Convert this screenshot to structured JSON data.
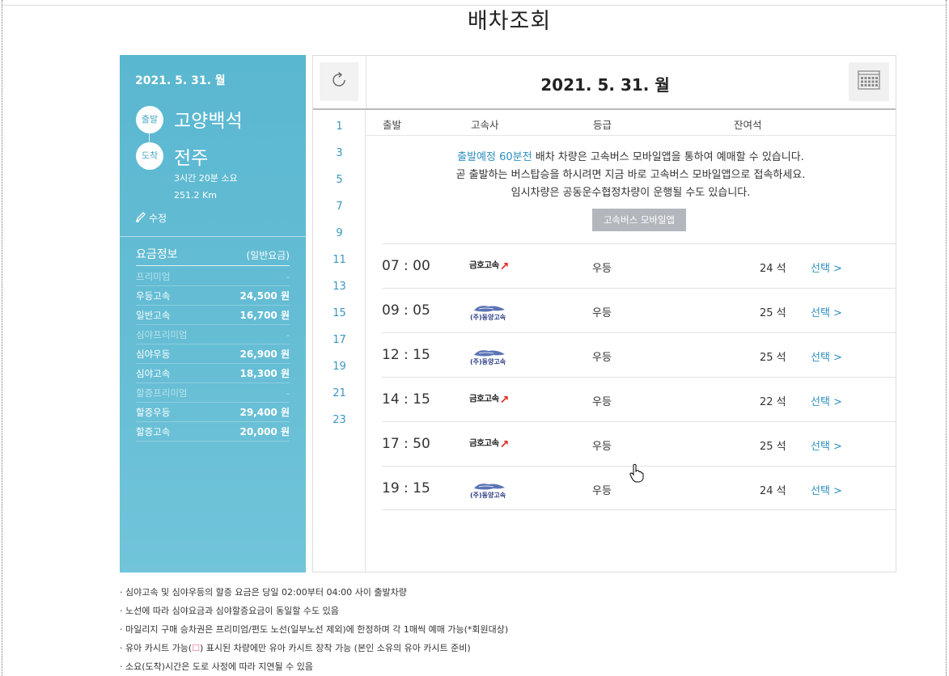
{
  "page": {
    "title": "배차조회"
  },
  "summary": {
    "date": "2021. 5. 31. 월",
    "departure_badge": "출발",
    "departure": "고양백석",
    "arrival_badge": "도착",
    "arrival": "전주",
    "duration": "3시간 20분 소요",
    "distance": "251.2 Km",
    "edit_label": "수정"
  },
  "fare": {
    "title": "요금정보",
    "subtitle": "(일반요금)",
    "rows": [
      {
        "label": "프리미엄",
        "value": "-"
      },
      {
        "label": "우등고속",
        "value": "24,500 원"
      },
      {
        "label": "일반고속",
        "value": "16,700 원"
      },
      {
        "label": "심야프리미엄",
        "value": "-"
      },
      {
        "label": "심야우등",
        "value": "26,900 원"
      },
      {
        "label": "심야고속",
        "value": "18,300 원"
      },
      {
        "label": "할증프리미엄",
        "value": "-"
      },
      {
        "label": "할증우등",
        "value": "29,400 원"
      },
      {
        "label": "할증고속",
        "value": "20,000 원"
      }
    ]
  },
  "schedule": {
    "date": "2021. 5. 31. 월",
    "hours": [
      "1",
      "3",
      "5",
      "7",
      "9",
      "11",
      "13",
      "15",
      "17",
      "19",
      "21",
      "23"
    ],
    "columns": {
      "departure": "출발",
      "carrier": "고속사",
      "grade": "등급",
      "seats": "잔여석"
    },
    "notice": {
      "highlight": "출발예정 60분전",
      "line1_rest": " 배차 차량은 고속버스 모바일앱을 통하여 예매할 수 있습니다.",
      "line2": "곧 출발하는 버스탑승을 하시려면 지금 바로 고속버스 모바일앱으로 접속하세요.",
      "line3": "임시차량은 공동운수협정차량이 운행될 수도 있습니다."
    },
    "app_button": "고속버스 모바일앱",
    "buses": [
      {
        "time": "07 : 00",
        "carrier": "금호고속",
        "grade": "우등",
        "seats": "24 석",
        "select": "선택 >"
      },
      {
        "time": "09 : 05",
        "carrier": "(주)동양고속",
        "grade": "우등",
        "seats": "25 석",
        "select": "선택 >"
      },
      {
        "time": "12 : 15",
        "carrier": "(주)동양고속",
        "grade": "우등",
        "seats": "25 석",
        "select": "선택 >"
      },
      {
        "time": "14 : 15",
        "carrier": "금호고속",
        "grade": "우등",
        "seats": "22 석",
        "select": "선택 >"
      },
      {
        "time": "17 : 50",
        "carrier": "금호고속",
        "grade": "우등",
        "seats": "25 석",
        "select": "선택 >"
      },
      {
        "time": "19 : 15",
        "carrier": "(주)동양고속",
        "grade": "우등",
        "seats": "24 석",
        "select": "선택 >"
      }
    ]
  },
  "notes": {
    "n1": "· 심야고속 및 심야우등의 할증 요금은 당일 02:00부터 04:00 사이 출발차량",
    "n2": "· 노선에 따라 심야요금과 심야할증요금이 동일할 수도 있음",
    "n3": "· 마일리지 구매 승차권은 프리미엄/편도 노선(일부노선 제외)에 한정하며 각 1매씩 예매 가능(*회원대상)",
    "n4a": "· 유아 카시트 가능(",
    "n4b": ") 표시된 차량에만 유아 카시트 장착 가능 (본인 소유의 유아 카시트 준비)",
    "n5": "· 소요(도착)시간은 도로 사정에 따라 지연될 수 있음"
  },
  "colors": {
    "panel": "#5ab7d0",
    "accent_blue": "#2f8fbf",
    "kumho_red": "#e2231a"
  }
}
